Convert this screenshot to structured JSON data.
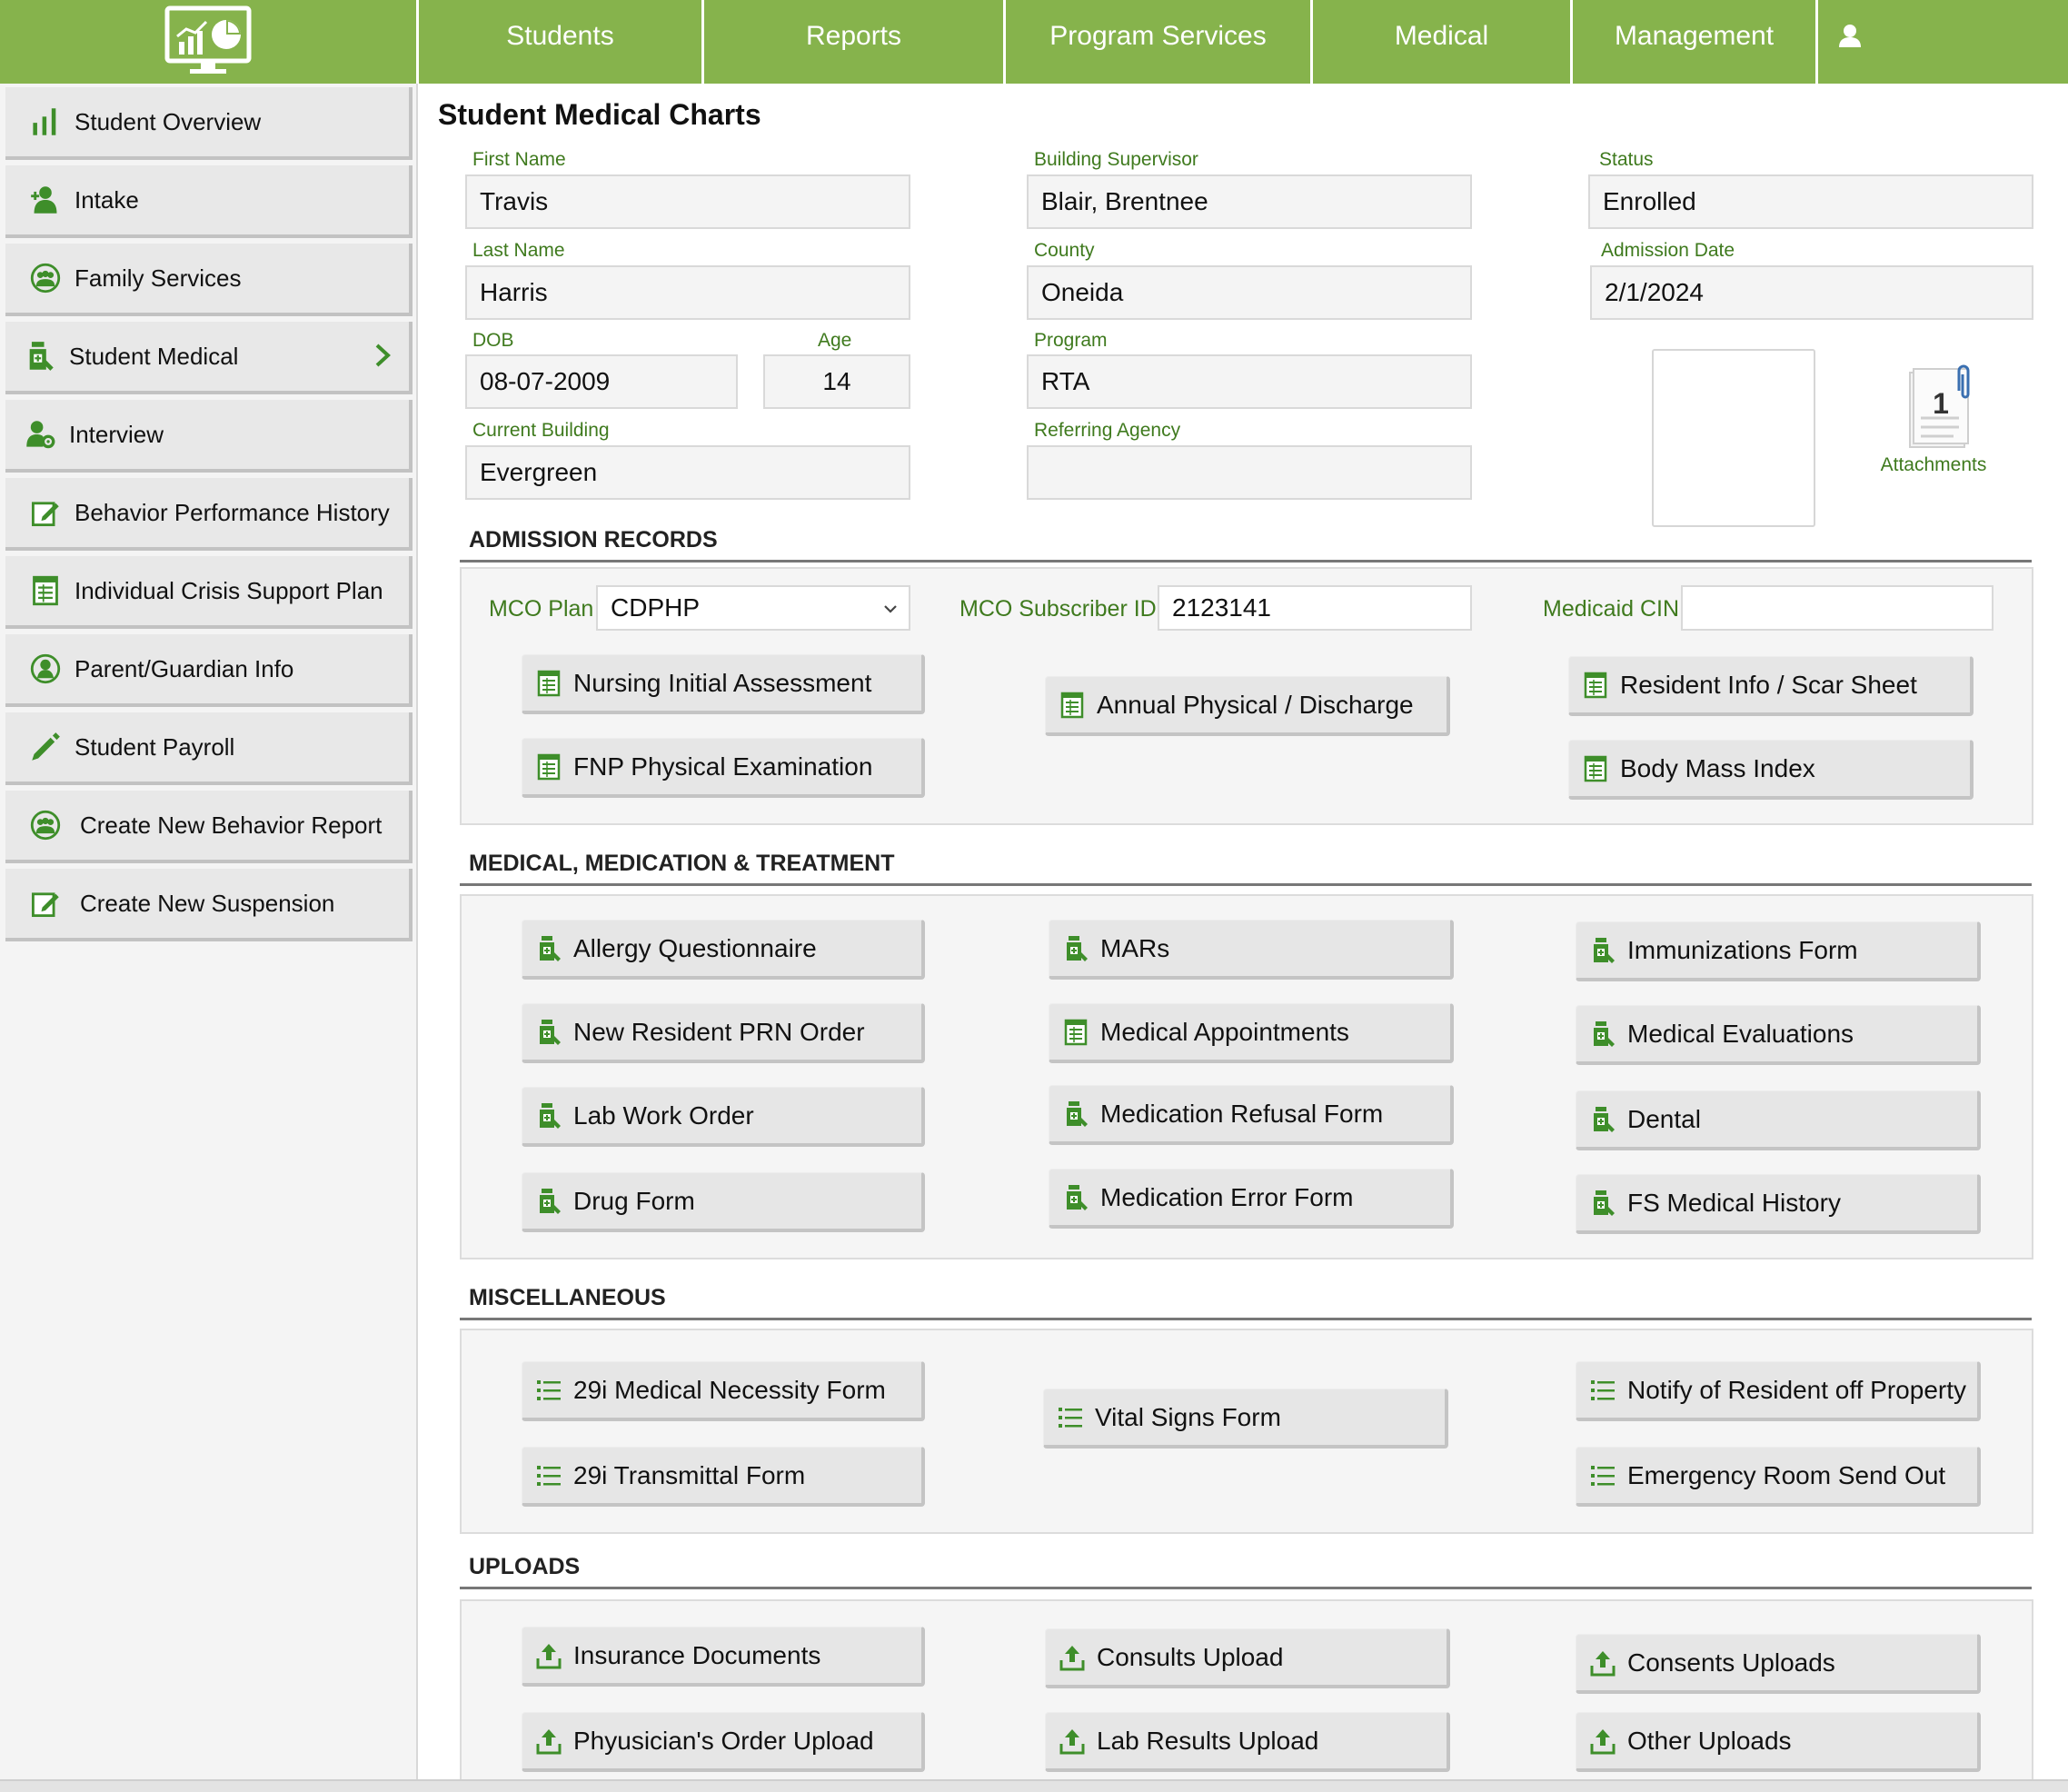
{
  "nav": {
    "items": [
      "Students",
      "Reports",
      "Program Services",
      "Medical",
      "Management"
    ]
  },
  "colors": {
    "brand_green": "#86b34c",
    "label_green": "#3f7a1e",
    "icon_green": "#3e8e2a"
  },
  "sidebar": {
    "items": [
      {
        "label": "Student Overview",
        "icon": "bar-chart-icon"
      },
      {
        "label": "Intake",
        "icon": "user-add-icon"
      },
      {
        "label": "Family Services",
        "icon": "group-icon"
      },
      {
        "label": "Student Medical",
        "icon": "medicine-bottle-icon"
      },
      {
        "label": "Interview",
        "icon": "user-gear-icon"
      },
      {
        "label": "Behavior Performance History",
        "icon": "edit-note-icon"
      },
      {
        "label": "Individual Crisis Support Plan",
        "icon": "form-icon"
      },
      {
        "label": "Parent/Guardian Info",
        "icon": "person-circle-icon"
      },
      {
        "label": "Student Payroll",
        "icon": "pencil-icon"
      },
      {
        "label": "Create New Behavior Report",
        "icon": "group-icon"
      },
      {
        "label": "Create New Suspension",
        "icon": "edit-note-icon"
      }
    ]
  },
  "page": {
    "title": "Student Medical Charts"
  },
  "student": {
    "first_name": {
      "label": "First Name",
      "value": "Travis"
    },
    "last_name": {
      "label": "Last Name",
      "value": "Harris"
    },
    "dob": {
      "label": "DOB",
      "value": "08-07-2009"
    },
    "age": {
      "label": "Age",
      "value": "14"
    },
    "current_building": {
      "label": "Current Building",
      "value": "Evergreen"
    },
    "building_supervisor": {
      "label": "Building Supervisor",
      "value": "Blair, Brentnee"
    },
    "county": {
      "label": "County",
      "value": "Oneida"
    },
    "program": {
      "label": "Program",
      "value": "RTA"
    },
    "referring_agency": {
      "label": "Referring Agency",
      "value": ""
    },
    "status": {
      "label": "Status",
      "value": "Enrolled"
    },
    "admission_date": {
      "label": "Admission Date",
      "value": "2/1/2024"
    }
  },
  "attachments": {
    "label": "Attachments",
    "count": "1"
  },
  "admission": {
    "title": "ADMISSION RECORDS",
    "mco_plan": {
      "label": "MCO Plan",
      "value": "CDPHP"
    },
    "mco_subscriber": {
      "label": "MCO Subscriber ID",
      "value": "2123141"
    },
    "medicaid": {
      "label": "Medicaid CIN",
      "value": ""
    },
    "buttons": [
      "Nursing Initial Assessment",
      "FNP Physical Examination",
      "Annual Physical / Discharge",
      "Resident Info / Scar Sheet",
      "Body Mass Index"
    ]
  },
  "medical": {
    "title": "MEDICAL, MEDICATION & TREATMENT",
    "buttons": [
      "Allergy Questionnaire",
      "New Resident PRN Order",
      "Lab Work Order",
      "Drug Form",
      "MARs",
      "Medical Appointments",
      "Medication Refusal Form",
      "Medication Error Form",
      "Immunizations Form",
      "Medical Evaluations",
      "Dental",
      "FS Medical History"
    ]
  },
  "misc": {
    "title": "MISCELLANEOUS",
    "buttons": [
      "29i Medical Necessity Form",
      "29i Transmittal Form",
      "Vital Signs Form",
      "Notify of Resident off Property",
      "Emergency Room Send Out"
    ]
  },
  "uploads": {
    "title": "UPLOADS",
    "buttons": [
      "Insurance Documents",
      "Phyusician's Order Upload",
      "Consults Upload",
      "Lab Results Upload",
      "Consents Uploads",
      "Other Uploads"
    ]
  }
}
